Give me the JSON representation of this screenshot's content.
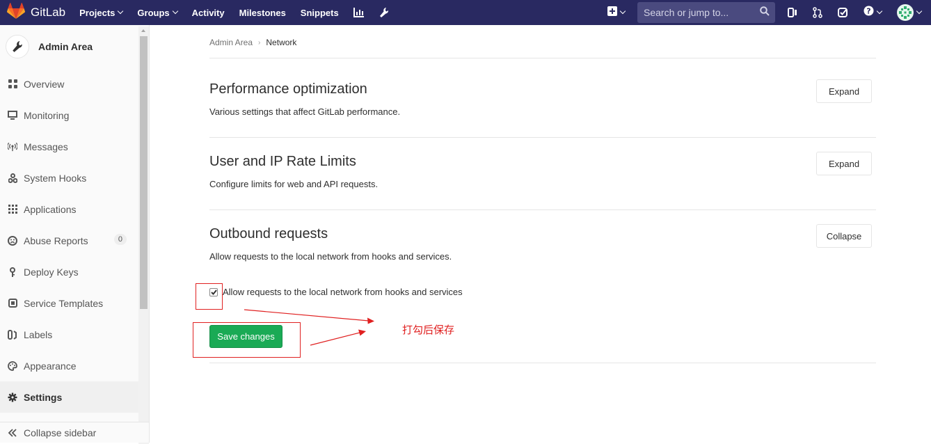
{
  "navbar": {
    "brand": "GitLab",
    "links": [
      {
        "label": "Projects",
        "dropdown": true
      },
      {
        "label": "Groups",
        "dropdown": true
      },
      {
        "label": "Activity",
        "dropdown": false
      },
      {
        "label": "Milestones",
        "dropdown": false
      },
      {
        "label": "Snippets",
        "dropdown": false
      }
    ],
    "search_placeholder": "Search or jump to..."
  },
  "sidebar": {
    "title": "Admin Area",
    "items": [
      {
        "label": "Overview",
        "icon": "overview-icon"
      },
      {
        "label": "Monitoring",
        "icon": "monitor-icon"
      },
      {
        "label": "Messages",
        "icon": "broadcast-icon"
      },
      {
        "label": "System Hooks",
        "icon": "hook-icon"
      },
      {
        "label": "Applications",
        "icon": "apps-icon"
      },
      {
        "label": "Abuse Reports",
        "icon": "abuse-icon",
        "badge": "0"
      },
      {
        "label": "Deploy Keys",
        "icon": "key-icon"
      },
      {
        "label": "Service Templates",
        "icon": "template-icon"
      },
      {
        "label": "Labels",
        "icon": "labels-icon"
      },
      {
        "label": "Appearance",
        "icon": "appearance-icon"
      },
      {
        "label": "Settings",
        "icon": "settings-icon",
        "active": true
      }
    ],
    "collapse_label": "Collapse sidebar"
  },
  "breadcrumb": {
    "parent": "Admin Area",
    "current": "Network"
  },
  "sections": [
    {
      "title": "Performance optimization",
      "description": "Various settings that affect GitLab performance.",
      "button": "Expand"
    },
    {
      "title": "User and IP Rate Limits",
      "description": "Configure limits for web and API requests.",
      "button": "Expand"
    },
    {
      "title": "Outbound requests",
      "description": "Allow requests to the local network from hooks and services.",
      "button": "Collapse"
    }
  ],
  "outbound_form": {
    "checkbox_label": "Allow requests to the local network from hooks and services",
    "checked": true,
    "save_label": "Save changes"
  },
  "annotation": {
    "text": "打勾后保存",
    "color": "#e02020"
  },
  "colors": {
    "navbar": "#292961",
    "primary_button": "#1aaa55"
  }
}
